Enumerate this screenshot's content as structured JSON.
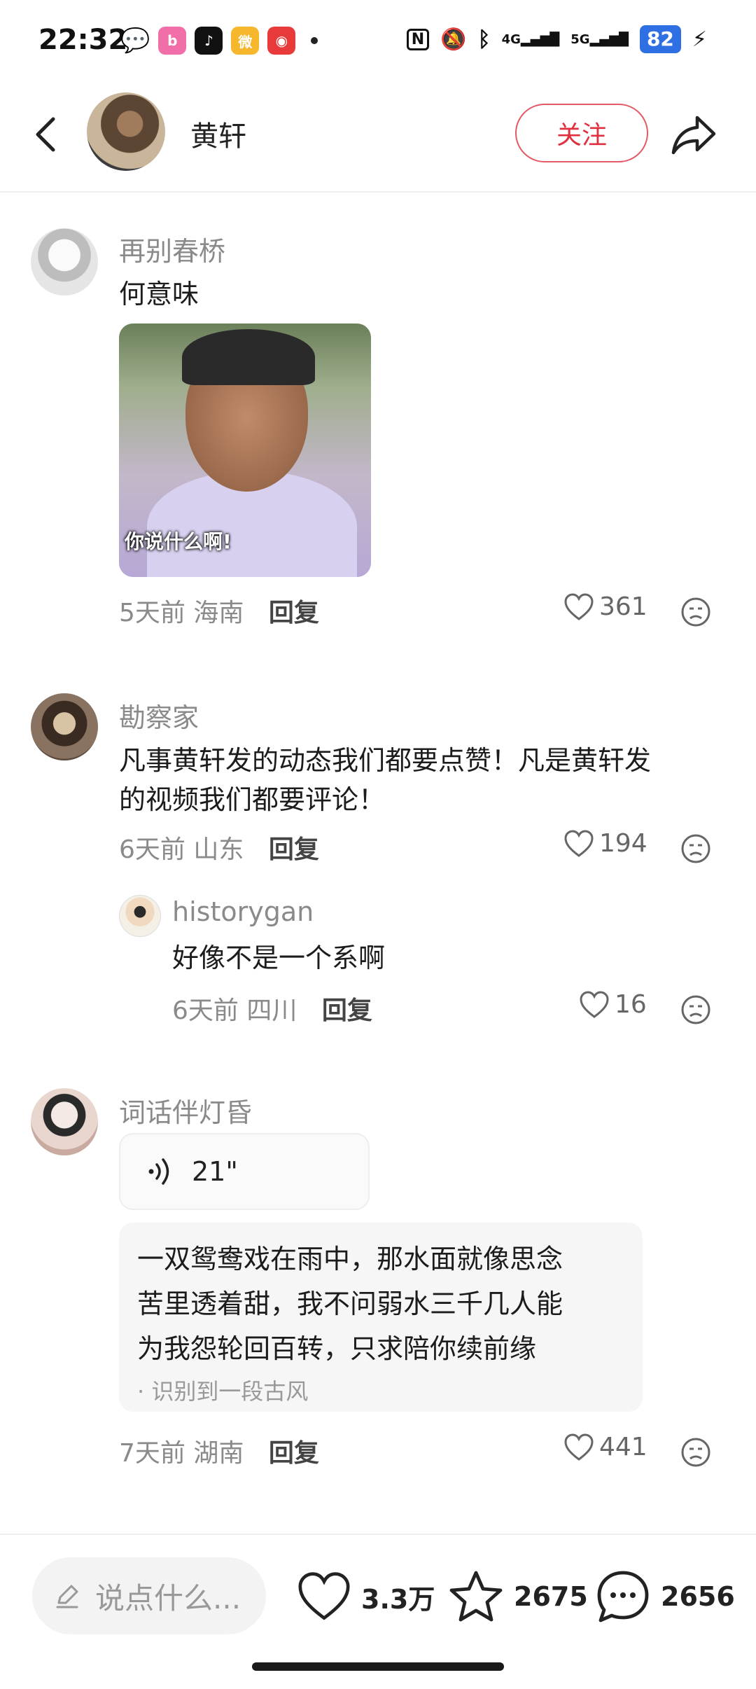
{
  "status_bar": {
    "time": "22:32",
    "network_4g": "4G",
    "network_5g": "5G",
    "battery": "82",
    "apps": [
      "wechat",
      "bilibili",
      "douyin",
      "weibo",
      "netease-music"
    ]
  },
  "header": {
    "name": "黄轩",
    "follow_label": "关注"
  },
  "comments": [
    {
      "user": "再别春桥",
      "text": "何意味",
      "image_caption": "你说什么啊!",
      "time": "5天前",
      "location": "海南",
      "reply_label": "回复",
      "likes": "361"
    },
    {
      "user": "勘察家",
      "text_line1": "凡事黄轩发的动态我们都要点赞！凡是黄轩发",
      "text_line2": "的视频我们都要评论！",
      "time": "6天前",
      "location": "山东",
      "reply_label": "回复",
      "likes": "194",
      "sub_reply": {
        "user": "historygan",
        "text": "好像不是一个系啊",
        "time": "6天前",
        "location": "四川",
        "reply_label": "回复",
        "likes": "16"
      }
    },
    {
      "user": "词话伴灯昏",
      "voice_duration": "21\"",
      "transcript_line1": "一双鸳鸯戏在雨中，那水面就像思念",
      "transcript_line2": "苦里透着甜，我不问弱水三千几人能",
      "transcript_line3": "为我怨轮回百转，只求陪你续前缘",
      "recognized_label": "· 识别到一段古风",
      "time": "7天前",
      "location": "湖南",
      "reply_label": "回复",
      "likes": "441"
    }
  ],
  "bottom_bar": {
    "input_placeholder": "说点什么...",
    "likes": "3.3万",
    "favorites": "2675",
    "comments": "2656"
  },
  "colors": {
    "follow_red": "#e0303f",
    "text_gray": "#8a8a8a",
    "battery_blue": "#2f6fe4"
  }
}
